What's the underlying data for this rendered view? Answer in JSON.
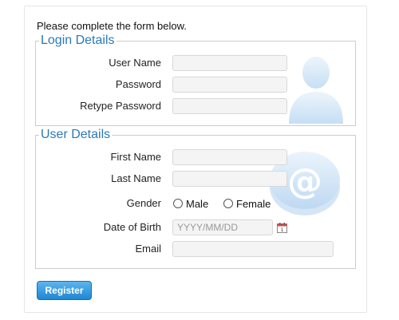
{
  "intro": "Please complete the form below.",
  "login_section": {
    "legend": "Login Details",
    "username_label": "User Name",
    "password_label": "Password",
    "retype_password_label": "Retype Password"
  },
  "user_section": {
    "legend": "User Details",
    "first_name_label": "First Name",
    "last_name_label": "Last Name",
    "gender_label": "Gender",
    "gender_options": [
      "Male",
      "Female"
    ],
    "dob_label": "Date of Birth",
    "dob_placeholder": "YYYY/MM/DD",
    "email_label": "Email"
  },
  "register_button": "Register",
  "icons": {
    "login_decoration": "user-silhouette-icon",
    "user_decoration": "at-sign-icon",
    "calendar": "calendar-icon"
  },
  "colors": {
    "legend": "#2a7ab8",
    "button": "#1e86d3"
  }
}
